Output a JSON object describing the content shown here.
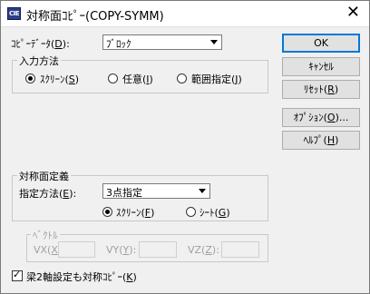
{
  "window": {
    "title": "対称面ｺﾋﾟｰ(COPY-SYMM)",
    "icon_text": "CIE"
  },
  "copy_data": {
    "label": "ｺﾋﾟｰﾃﾞｰﾀ(",
    "accel": "D",
    "label_end": "):",
    "value": "ﾌﾞﾛｯｸ"
  },
  "input_method": {
    "group_title": "入力方法",
    "options": [
      {
        "label": "ｽｸﾘｰﾝ(",
        "accel": "S",
        "end": ")",
        "selected": true
      },
      {
        "label": "任意(",
        "accel": "I",
        "end": ")",
        "selected": false
      },
      {
        "label": "範囲指定(",
        "accel": "J",
        "end": ")",
        "selected": false
      }
    ]
  },
  "buttons": {
    "ok": "OK",
    "cancel": "ｷｬﾝｾﾙ",
    "reset_label": "ﾘｾｯﾄ(",
    "reset_accel": "R",
    "reset_end": ")",
    "option_label": "ｵﾌﾟｼｮﾝ(",
    "option_accel": "O",
    "option_end": ")...",
    "help_label": "ﾍﾙﾌﾟ(",
    "help_accel": "H",
    "help_end": ")"
  },
  "symmetry_plane": {
    "group_title": "対称面定義",
    "method_label": "指定方法(",
    "method_accel": "E",
    "method_end": "):",
    "method_value": "3点指定",
    "options": [
      {
        "label": "ｽｸﾘｰﾝ(",
        "accel": "F",
        "end": ")",
        "selected": true
      },
      {
        "label": "ｼｰﾄ(",
        "accel": "G",
        "end": ")",
        "selected": false
      }
    ]
  },
  "vector": {
    "group_title": "ﾍﾞｸﾄﾙ",
    "vx_label": "VX(",
    "vx_accel": "X",
    "vx_end": "):",
    "vy_label": "VY(",
    "vy_accel": "Y",
    "vy_end": "):",
    "vz_label": "VZ(",
    "vz_accel": "Z",
    "vz_end": "):",
    "vx_value": "",
    "vy_value": "",
    "vz_value": "",
    "enabled": false
  },
  "beam_copy": {
    "label": "梁2軸設定も対称ｺﾋﾟｰ(",
    "accel": "K",
    "end": ")",
    "checked": true
  }
}
